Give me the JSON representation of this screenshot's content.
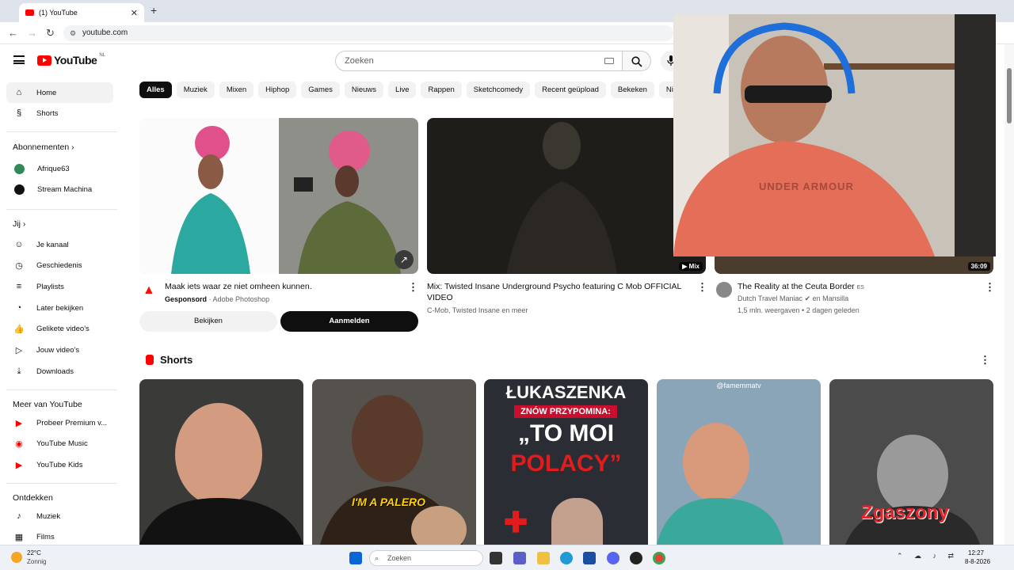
{
  "browser": {
    "tab_title": "(1) YouTube",
    "tab_close": "✕",
    "new_tab": "+",
    "url": "youtube.com"
  },
  "header": {
    "logo_text": "YouTube",
    "country_code": "NL",
    "search_placeholder": "Zoeken"
  },
  "sidebar": {
    "top": [
      {
        "label": "Home",
        "icon": "home-icon"
      },
      {
        "label": "Shorts",
        "icon": "shorts-icon"
      }
    ],
    "subs_header": "Abonnementen",
    "subs": [
      {
        "label": "Afrique63",
        "color": "#2e8b57"
      },
      {
        "label": "Stream Machina",
        "color": "#111111"
      }
    ],
    "you_header": "Jij",
    "you": [
      {
        "label": "Je kanaal",
        "icon": "channel-icon"
      },
      {
        "label": "Geschiedenis",
        "icon": "history-icon"
      },
      {
        "label": "Playlists",
        "icon": "playlists-icon"
      },
      {
        "label": "Later bekijken",
        "icon": "watch-later-icon"
      },
      {
        "label": "Gelikete video's",
        "icon": "like-icon"
      },
      {
        "label": "Jouw video's",
        "icon": "your-videos-icon"
      },
      {
        "label": "Downloads",
        "icon": "download-icon"
      }
    ],
    "more_header": "Meer van YouTube",
    "more": [
      {
        "label": "Probeer Premium v...",
        "icon": "premium-icon"
      },
      {
        "label": "YouTube Music",
        "icon": "music-icon"
      },
      {
        "label": "YouTube Kids",
        "icon": "kids-icon"
      }
    ],
    "explore_header": "Ontdekken",
    "explore": [
      {
        "label": "Muziek",
        "icon": "music-note-icon"
      },
      {
        "label": "Films",
        "icon": "film-icon"
      }
    ]
  },
  "chips": [
    "Alles",
    "Muziek",
    "Mixen",
    "Hiphop",
    "Games",
    "Nieuws",
    "Live",
    "Rappen",
    "Sketchcomedy",
    "Recent geüpload",
    "Bekeken",
    "Nieu"
  ],
  "videos": {
    "ad": {
      "title": "Maak iets waar ze niet omheen kunnen.",
      "sponsored": "Gesponsord",
      "sep": " · ",
      "advertiser": "Adobe Photoshop",
      "btn_watch": "Bekijken",
      "btn_signup": "Aanmelden"
    },
    "mix": {
      "title": "Mix: Twisted Insane Underground Psycho featuring C Mob OFFICIAL VIDEO",
      "channel": "C-Mob, Twisted Insane en meer",
      "badge": "Mix"
    },
    "ceuta": {
      "title": "The Reality at the Ceuta Border",
      "title_suffix": "ES",
      "channel": "Dutch Travel Maniac",
      "collab": "en Mansilla",
      "views": "1,5 mln. weergaven • 2 dagen geleden",
      "duration": "36:09"
    }
  },
  "shorts": {
    "title": "Shorts",
    "items": [
      {
        "overlay": ""
      },
      {
        "overlay": "I'M A PALERO"
      },
      {
        "line1": "ŁUKASZENKA",
        "line2": "ZNÓW PRZYPOMINA:",
        "line3": "„TO MOI",
        "line4": "POLACY”"
      },
      {
        "overlay": "@famemmatv"
      },
      {
        "overlay": "Zgaszony"
      }
    ]
  },
  "webcam": {
    "shirt_text": "UNDER ARMOUR"
  },
  "taskbar": {
    "weather_temp": "22°C",
    "weather_desc": "Zonnig",
    "search": "Zoeken",
    "time": "12:27",
    "date": "8-8-2026"
  },
  "colors": {
    "brand_red": "#ff0000",
    "chip_selected": "#0f0f0f",
    "chip_bg": "#f2f2f2"
  }
}
